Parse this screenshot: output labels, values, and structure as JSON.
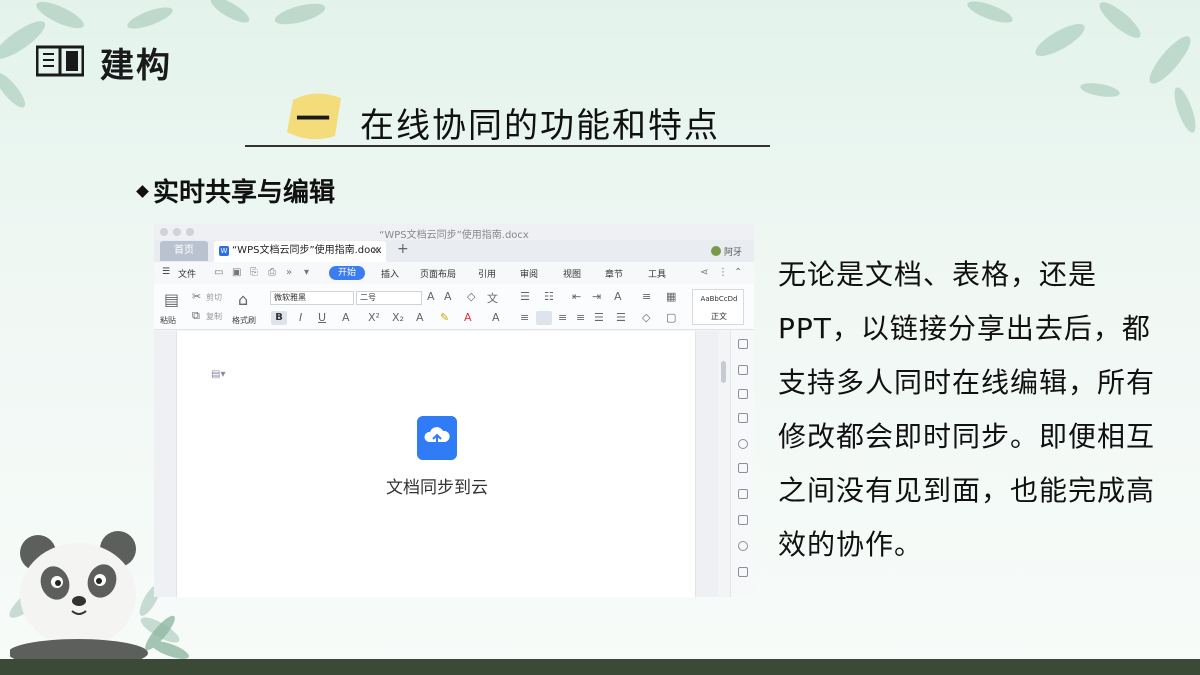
{
  "header": {
    "title": "建构",
    "icon": "open-book-icon"
  },
  "section": {
    "number": "一",
    "title": "在线协同的功能和特点"
  },
  "bullet": {
    "text": "实时共享与编辑"
  },
  "wps": {
    "window_title": "“WPS文档云同步”使用指南.docx",
    "tabs": {
      "home": "首页",
      "document": "“WPS文档云同步”使用指南.docx",
      "close": "✕",
      "add": "+"
    },
    "user_name": "阿牙",
    "menu": {
      "file": "文件",
      "start": "开始",
      "items": [
        "插入",
        "页面布局",
        "引用",
        "审阅",
        "视图",
        "章节",
        "工具"
      ]
    },
    "ribbon": {
      "paste": "粘贴",
      "cut": "剪切",
      "copy": "复制",
      "format_painter": "格式刷",
      "font": "微软雅黑",
      "size": "二号",
      "style_sample": "AaBbCcDd",
      "style_name": "正文"
    },
    "body": {
      "cloud_label": "文档同步到云"
    }
  },
  "paragraph": "无论是文档、表格，还是PPT，以链接分享出去后，都支持多人同时在线编辑，所有修改都会即时同步。即便相互之间没有见到面，也能完成高效的协作。",
  "colors": {
    "accent_blue": "#2f7cf6",
    "badge_yellow": "#f5dc7a",
    "footer": "#3a4a36"
  }
}
